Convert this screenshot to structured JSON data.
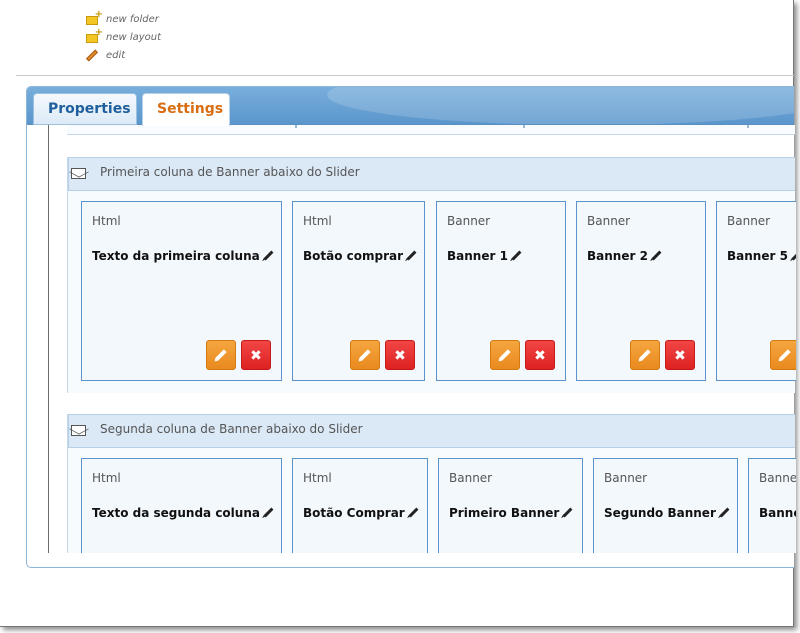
{
  "actions": [
    {
      "label": "new folder",
      "icon": "new-folder-icon"
    },
    {
      "label": "new layout",
      "icon": "new-layout-icon"
    },
    {
      "label": "edit",
      "icon": "pencil-icon"
    }
  ],
  "tabs": {
    "properties": "Properties",
    "settings": "Settings",
    "active": "Settings"
  },
  "colors": {
    "tab_active_text": "#d86d12",
    "tab_inactive_text": "#1f5f9e",
    "edit_button": "#ee951f",
    "delete_button": "#e32a2a",
    "card_border": "#5b94cc"
  },
  "sections": [
    {
      "title": "Primeira coluna de Banner abaixo do Slider",
      "cards": [
        {
          "type": "Html",
          "name": "Texto da primeira coluna"
        },
        {
          "type": "Html",
          "name": "Botão comprar"
        },
        {
          "type": "Banner",
          "name": "Banner 1"
        },
        {
          "type": "Banner",
          "name": "Banner 2"
        },
        {
          "type": "Banner",
          "name": "Banner 5"
        }
      ]
    },
    {
      "title": "Segunda coluna de Banner abaixo do Slider",
      "cards": [
        {
          "type": "Html",
          "name": "Texto da segunda coluna"
        },
        {
          "type": "Html",
          "name": "Botão Comprar"
        },
        {
          "type": "Banner",
          "name": "Primeiro Banner"
        },
        {
          "type": "Banner",
          "name": "Segundo Banner"
        },
        {
          "type": "Banner",
          "name": "Banner"
        }
      ]
    }
  ]
}
